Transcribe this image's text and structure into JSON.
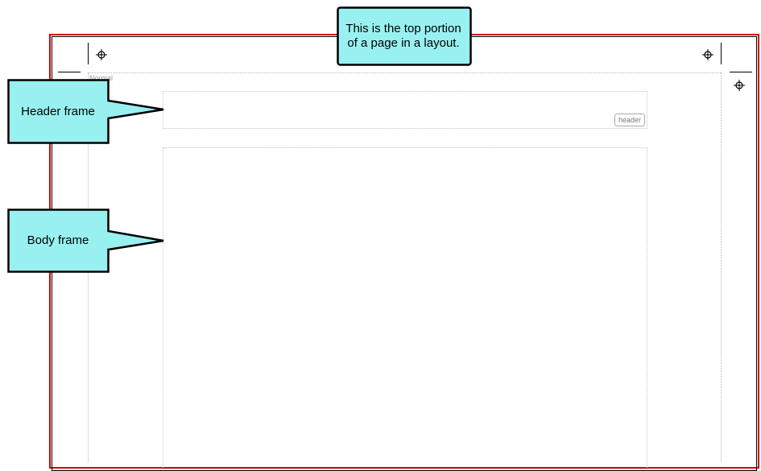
{
  "page": {
    "style_label": "Normal",
    "header_frame_tag": "header"
  },
  "callouts": {
    "top_note": "This is the top portion of a page in a layout.",
    "header_frame": "Header frame",
    "body_frame": "Body frame"
  },
  "icons": {
    "registration_mark": "target-crosshair-icon"
  },
  "colors": {
    "page_border": "#d40000",
    "callout_fill": "#99f0f0",
    "callout_border": "#000000"
  }
}
